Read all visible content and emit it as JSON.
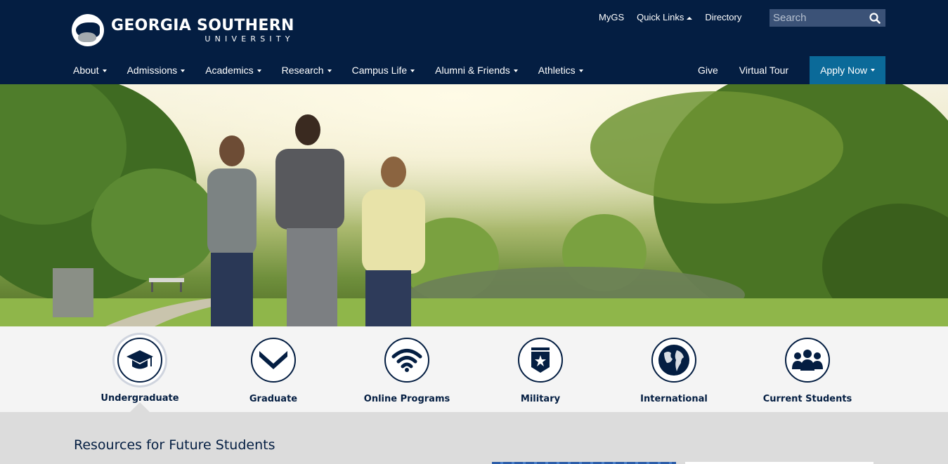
{
  "header": {
    "logo_title": "GEORGIA SOUTHERN",
    "logo_subtitle": "UNIVERSITY",
    "utility_links": [
      "MyGS",
      "Quick Links",
      "Directory"
    ],
    "search_placeholder": "Search"
  },
  "main_nav": [
    "About",
    "Admissions",
    "Academics",
    "Research",
    "Campus Life",
    "Alumni & Friends",
    "Athletics"
  ],
  "right_nav": {
    "give": "Give",
    "virtual_tour": "Virtual Tour",
    "apply_now": "Apply Now"
  },
  "audience": [
    {
      "label": "Undergraduate",
      "icon": "graduation-cap-icon",
      "active": true
    },
    {
      "label": "Graduate",
      "icon": "chevron-badge-icon",
      "active": false
    },
    {
      "label": "Online Programs",
      "icon": "wifi-icon",
      "active": false
    },
    {
      "label": "Military",
      "icon": "star-shield-icon",
      "active": false
    },
    {
      "label": "International",
      "icon": "globe-icon",
      "active": false
    },
    {
      "label": "Current Students",
      "icon": "group-icon",
      "active": false
    }
  ],
  "resources": {
    "title": "Resources for Future Students"
  },
  "colors": {
    "navy": "#041e42",
    "apply_blue": "#0b6a99",
    "search_bg": "#3b5277",
    "audience_bg": "#f4f4f4",
    "resources_bg": "#dcdcdc"
  }
}
